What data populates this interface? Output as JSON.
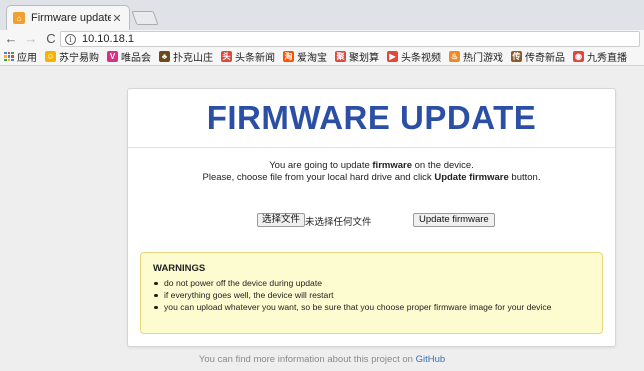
{
  "browser": {
    "tab": {
      "title": "Firmware update",
      "close": "✕"
    },
    "nav": {
      "back": "←",
      "forward": "→",
      "reload": "C"
    },
    "address": {
      "info": "i",
      "url": "10.10.18.1"
    }
  },
  "bookmarks": [
    {
      "label": "应用",
      "icon": "apps-grid",
      "color": "#4a7fd8"
    },
    {
      "label": "苏宁易购",
      "icon": "suning",
      "color": "#f5b400",
      "glyph": "☺"
    },
    {
      "label": "唯品会",
      "icon": "vip",
      "color": "#d63384",
      "glyph": "V"
    },
    {
      "label": "扑克山庄",
      "icon": "poker",
      "color": "#6b4a20",
      "glyph": "♣"
    },
    {
      "label": "头条新闻",
      "icon": "toutiao",
      "color": "#e0483e",
      "glyph": "头"
    },
    {
      "label": "爱淘宝",
      "icon": "taobao",
      "color": "#ff5000",
      "glyph": "淘"
    },
    {
      "label": "聚划算",
      "icon": "juhuasuan",
      "color": "#e0483e",
      "glyph": "聚"
    },
    {
      "label": "头条视频",
      "icon": "video",
      "color": "#e0483e",
      "glyph": "▶"
    },
    {
      "label": "热门游戏",
      "icon": "games",
      "color": "#f08a24",
      "glyph": "♨"
    },
    {
      "label": "传奇新品",
      "icon": "legend",
      "color": "#8a5a2a",
      "glyph": "传"
    },
    {
      "label": "九秀直播",
      "icon": "live",
      "color": "#e0483e",
      "glyph": "◉"
    }
  ],
  "page": {
    "title": "FIRMWARE UPDATE",
    "intro_line1_pre": "You are going to update ",
    "intro_line1_bold": "firmware",
    "intro_line1_post": " on the device.",
    "intro_line2_pre": "Please, choose file from your local hard drive and click ",
    "intro_line2_bold": "Update firmware",
    "intro_line2_post": " button.",
    "choose_file_label": "选择文件",
    "no_file_text": "未选择任何文件",
    "update_button": "Update firmware",
    "warnings": {
      "title": "WARNINGS",
      "items": [
        "do not power off the device during update",
        "if everything goes well, the device will restart",
        "you can upload whatever you want, so be sure that you choose proper firmware image for your device"
      ]
    },
    "footer_pre": "You can find more information about this project on ",
    "footer_link": "GitHub"
  }
}
